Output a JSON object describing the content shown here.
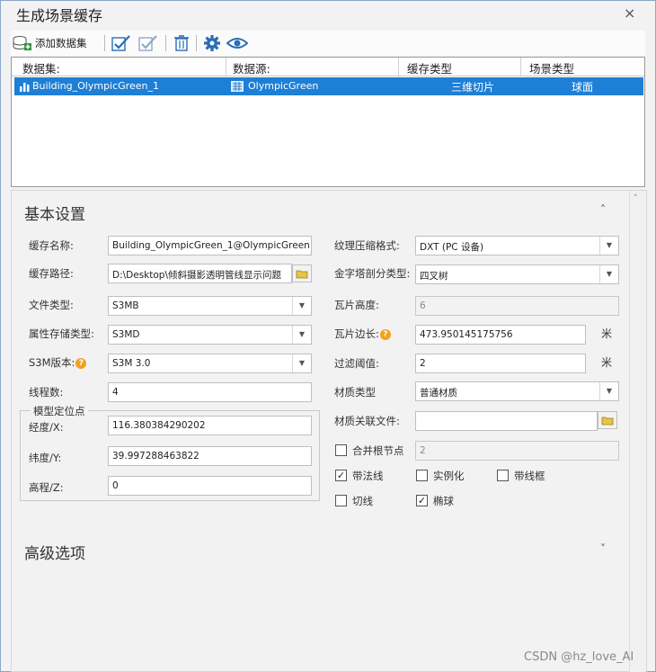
{
  "window": {
    "title": "生成场景缓存",
    "close": "×"
  },
  "toolbar": {
    "add_dataset": "添加数据集"
  },
  "grid": {
    "headers": [
      "数据集:",
      "数据源:",
      "缓存类型",
      "场景类型"
    ],
    "rows": [
      {
        "dataset": "Building_OlympicGreen_1",
        "datasource": "OlympicGreen",
        "cache_type": "三维切片",
        "scene_type": "球面"
      }
    ]
  },
  "basic": {
    "title": "基本设置",
    "cache_name_label": "缓存名称:",
    "cache_name_value": "Building_OlympicGreen_1@OlympicGreen",
    "cache_path_label": "缓存路径:",
    "cache_path_value": "D:\\Desktop\\倾斜摄影透明管线显示问题",
    "file_type_label": "文件类型:",
    "file_type_value": "S3MB",
    "attr_store_label": "属性存储类型:",
    "attr_store_value": "S3MD",
    "s3m_version_label": "S3M版本:",
    "s3m_version_value": "S3M 3.0",
    "threads_label": "线程数:",
    "threads_value": "4",
    "anchor_group": "模型定位点",
    "lon_label": "经度/X:",
    "lon_value": "116.380384290202",
    "lat_label": "纬度/Y:",
    "lat_value": "39.997288463822",
    "elev_label": "高程/Z:",
    "elev_value": "0",
    "texture_label": "纹理压缩格式:",
    "texture_value": "DXT (PC 设备)",
    "pyramid_label": "金字塔剖分类型:",
    "pyramid_value": "四叉树",
    "tile_height_label": "瓦片高度:",
    "tile_height_value": "6",
    "tile_edge_label": "瓦片边长:",
    "tile_edge_value": "473.950145175756",
    "tile_edge_unit": "米",
    "filter_label": "过滤阈值:",
    "filter_value": "2",
    "filter_unit": "米",
    "material_label": "材质类型",
    "material_value": "普通材质",
    "material_file_label": "材质关联文件:",
    "material_file_value": "",
    "merge_root_label": "合并根节点",
    "merge_root_value": "2",
    "normal_label": "带法线",
    "instance_label": "实例化",
    "wireframe_label": "带线框",
    "tangent_label": "切线",
    "ellipsoid_label": "椭球"
  },
  "advanced": {
    "title": "高级选项"
  },
  "watermark": "CSDN @hz_love_AI",
  "colors": {
    "selection": "#1e7fd6",
    "help": "#f0a220",
    "folder": "#e8c34a"
  }
}
